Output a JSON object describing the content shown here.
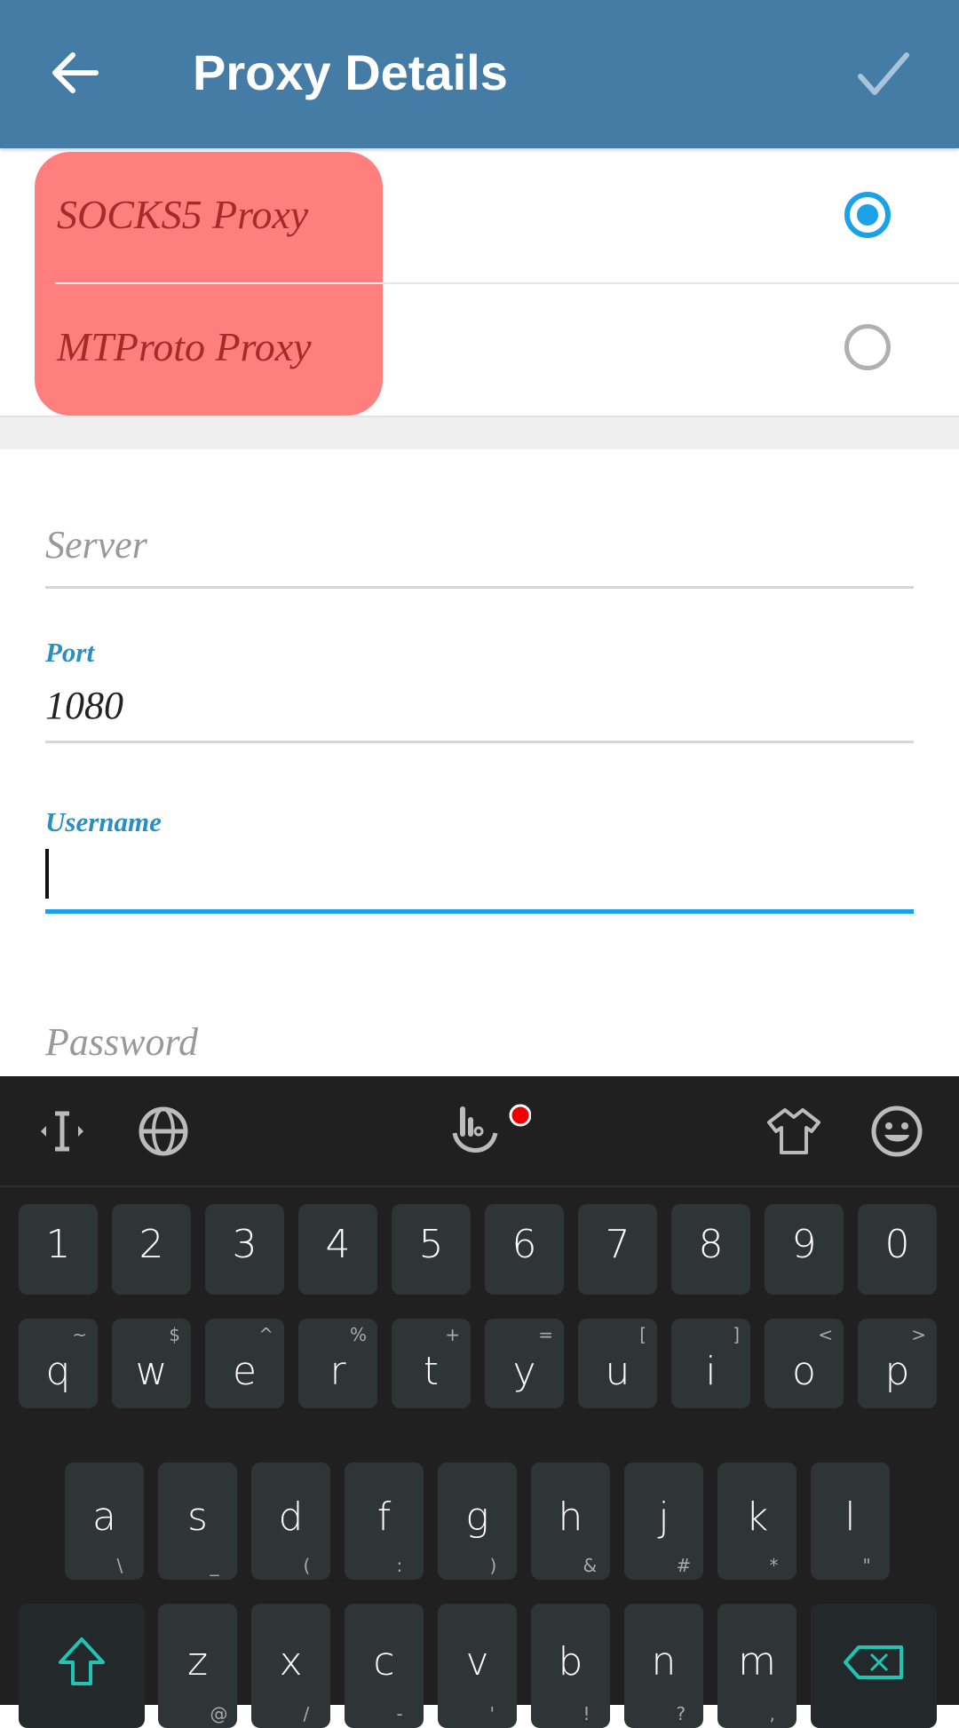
{
  "header": {
    "title": "Proxy Details",
    "back_icon": "arrow-left-icon",
    "done_icon": "check-icon"
  },
  "proxy_types": [
    {
      "label": "SOCKS5 Proxy",
      "selected": true
    },
    {
      "label": "MTProto Proxy",
      "selected": false
    }
  ],
  "colors": {
    "header": "#447ca6",
    "accent": "#1aa1e8",
    "highlight": "#ff7f7f",
    "highlight_text": "#a52a2a",
    "keyboard": "#202020",
    "key": "#2f3537",
    "keyboard_accent": "#1fc4b4"
  },
  "fields": {
    "server": {
      "placeholder": "Server"
    },
    "port": {
      "label": "Port",
      "value": "1080"
    },
    "username": {
      "label": "Username",
      "value": ""
    },
    "password": {
      "placeholder": "Password"
    }
  },
  "keyboard": {
    "toolbar": [
      "cursor-move-icon",
      "globe-icon",
      "touchpal-logo-icon",
      "theme-shirt-icon",
      "emoji-icon"
    ],
    "numbers": [
      "1",
      "2",
      "3",
      "4",
      "5",
      "6",
      "7",
      "8",
      "9",
      "0"
    ],
    "row1": [
      [
        "q",
        "~"
      ],
      [
        "w",
        "$"
      ],
      [
        "e",
        "^"
      ],
      [
        "r",
        "%"
      ],
      [
        "t",
        "+"
      ],
      [
        "y",
        "="
      ],
      [
        "u",
        "["
      ],
      [
        "i",
        "]"
      ],
      [
        "o",
        "<"
      ],
      [
        "p",
        ">"
      ]
    ],
    "row2": [
      [
        "a",
        "\\"
      ],
      [
        "s",
        "_"
      ],
      [
        "d",
        "("
      ],
      [
        "f",
        ":"
      ],
      [
        "g",
        ")"
      ],
      [
        "h",
        "&"
      ],
      [
        "j",
        "#"
      ],
      [
        "k",
        "*"
      ],
      [
        "l",
        "\""
      ]
    ],
    "row3": [
      [
        "z",
        "@"
      ],
      [
        "x",
        "/"
      ],
      [
        "c",
        "-"
      ],
      [
        "v",
        "'"
      ],
      [
        "b",
        "!"
      ],
      [
        "n",
        "?"
      ],
      [
        "m",
        ","
      ]
    ]
  }
}
